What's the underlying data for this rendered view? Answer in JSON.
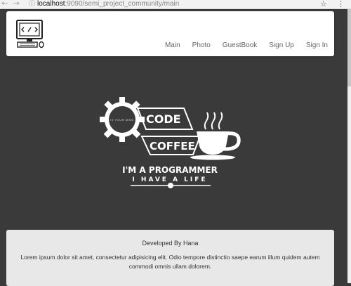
{
  "browser": {
    "url_host": "localhost",
    "url_path": ":9090/semi_project_community/main"
  },
  "nav": {
    "items": [
      {
        "label": "Main"
      },
      {
        "label": "Photo"
      },
      {
        "label": "GuestBook"
      },
      {
        "label": "Sign Up"
      },
      {
        "label": "Sign In"
      }
    ]
  },
  "hero": {
    "gear_text": "IS YOUR MIND",
    "code": "CODE",
    "coffee": "COFFEE",
    "line1": "I'M A PROGRAMMER",
    "line2": "I HAVE A LIFE"
  },
  "footer": {
    "credit": "Developed By Hana",
    "lorem": "Lorem ipsum dolor sit amet, consectetur adipisicing elit. Odio tempore distinctio saepe earum illum quidem autem commodi omnis ullam dolorem."
  },
  "colors": {
    "background": "#3a3a3a",
    "navbar": "#ffffff",
    "footer": "#e8e8e8",
    "logo_text": "#ffffff"
  }
}
